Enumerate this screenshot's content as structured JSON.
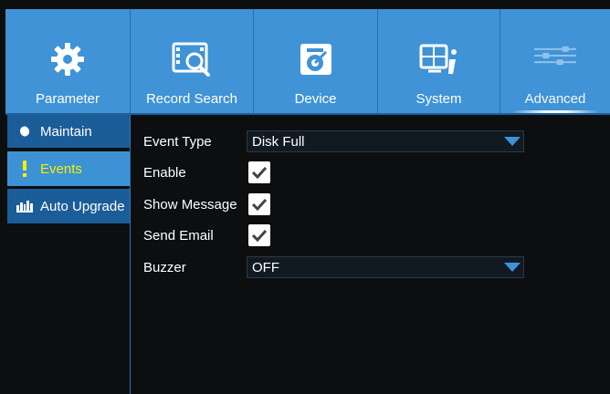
{
  "tabs": [
    {
      "label": "Parameter",
      "icon": "gear-icon"
    },
    {
      "label": "Record Search",
      "icon": "record-search-icon"
    },
    {
      "label": "Device",
      "icon": "device-icon"
    },
    {
      "label": "System",
      "icon": "system-icon"
    },
    {
      "label": "Advanced",
      "icon": "sliders-icon",
      "active": true
    }
  ],
  "sidebar": {
    "items": [
      {
        "label": "Maintain",
        "icon": "circle-icon"
      },
      {
        "label": "Events",
        "icon": "exclamation-icon",
        "active": true
      },
      {
        "label": "Auto Upgrade",
        "icon": "signal-bars-icon"
      }
    ]
  },
  "events_form": {
    "event_type": {
      "label": "Event Type",
      "value": "Disk Full"
    },
    "enable": {
      "label": "Enable",
      "checked": true
    },
    "show_message": {
      "label": "Show Message",
      "checked": true
    },
    "send_email": {
      "label": "Send Email",
      "checked": true
    },
    "buzzer": {
      "label": "Buzzer",
      "value": "OFF"
    }
  },
  "colors": {
    "tab_bar": "#3f93d6",
    "sidebar_item": "#1b5d99",
    "sidebar_active": "#3d92d5",
    "active_text": "#f5ef00",
    "background": "#0c0e10"
  }
}
